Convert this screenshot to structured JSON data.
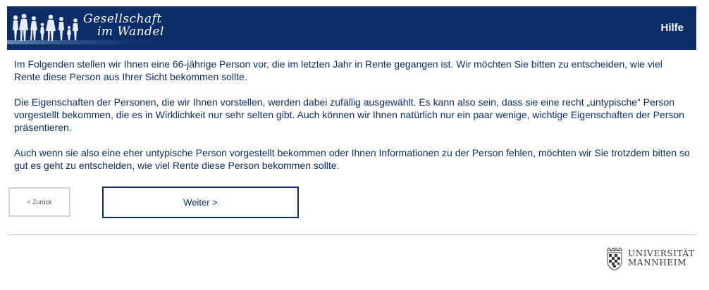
{
  "header": {
    "logo_line1": "Gesellschaft",
    "logo_line2": "im Wandel",
    "help_label": "Hilfe"
  },
  "content": {
    "paragraphs": [
      "Im Folgenden stellen wir Ihnen eine 66-jährige Person vor, die im letzten Jahr in Rente gegangen ist. Wir möchten Sie bitten zu entscheiden, wie viel Rente diese Person aus Ihrer Sicht bekommen sollte.",
      "Die Eigenschaften der Personen, die wir Ihnen vorstellen, werden dabei zufällig ausgewählt. Es kann also sein, dass sie eine recht „untypische“ Person vorgestellt bekommen, die es in Wirklichkeit nur sehr selten gibt. Auch können wir Ihnen natürlich nur ein paar wenige, wichtige Eigenschaften der Person präsentieren.",
      "Auch wenn sie also eine eher untypische Person vorgestellt bekommen oder Ihnen Informationen zu der Person fehlen, möchten wir Sie trotzdem bitten so gut es geht zu entscheiden, wie viel Rente diese Person bekommen sollte."
    ]
  },
  "navigation": {
    "back_label": "< Zurück",
    "next_label": "Weiter >"
  },
  "footer": {
    "university_line1": "UNIVERSITÄT",
    "university_line2": "MANNHEIM"
  },
  "colors": {
    "brand_navy": "#0c2d66",
    "divider": "#c8c8c8"
  }
}
